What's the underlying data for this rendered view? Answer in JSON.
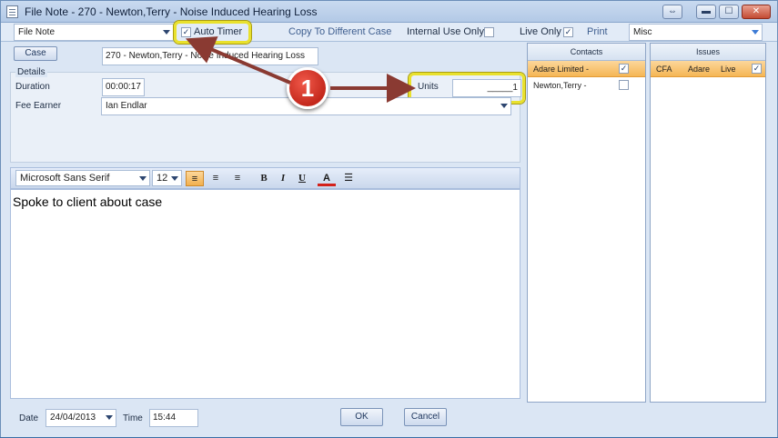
{
  "window": {
    "title": "File Note - 270 - Newton,Terry - Noise Induced Hearing Loss",
    "restore_glyph": "⇔",
    "min_glyph": "▬",
    "max_glyph": "☐",
    "close_glyph": "✕"
  },
  "toolbar": {
    "note_type": "File Note",
    "auto_timer_label": "Auto Timer",
    "auto_timer_checked": "✓",
    "copy_label": "Copy To Different Case",
    "internal_use_label": "Internal Use Only",
    "live_only_label": "Live Only",
    "live_only_checked": "✓",
    "print_label": "Print",
    "category": "Misc"
  },
  "details": {
    "case_button": "Case",
    "case_value": "270 - Newton,Terry - Noise Induced Hearing Loss",
    "section_label": "Details",
    "duration_label": "Duration",
    "duration_value": "00:00:17",
    "units_label": "Units",
    "units_value": "_____1",
    "fee_earner_label": "Fee Earner",
    "fee_earner_value": "Ian Endlar"
  },
  "editor": {
    "font_name": "Microsoft Sans Serif",
    "font_size": "12",
    "bold": "B",
    "italic": "I",
    "underline": "U",
    "color_letter": "A",
    "body_text": "Spoke to client about case"
  },
  "contacts": {
    "header": "Contacts",
    "rows": [
      {
        "name": "Adare Limited -",
        "checked": "✓"
      },
      {
        "name": "Newton,Terry -",
        "checked": ""
      }
    ]
  },
  "issues": {
    "header": "Issues",
    "row": {
      "code": "CFA",
      "client": "Adare",
      "status": "Live",
      "checked": "✓"
    }
  },
  "footer": {
    "date_label": "Date",
    "date_value": "24/04/2013",
    "time_label": "Time",
    "time_value": "15:44",
    "ok_label": "OK",
    "cancel_label": "Cancel"
  },
  "callout": {
    "number": "1"
  },
  "colors": {
    "highlight": "#e9e12d",
    "callout": "#c4281c",
    "selection": "#f5b655"
  }
}
